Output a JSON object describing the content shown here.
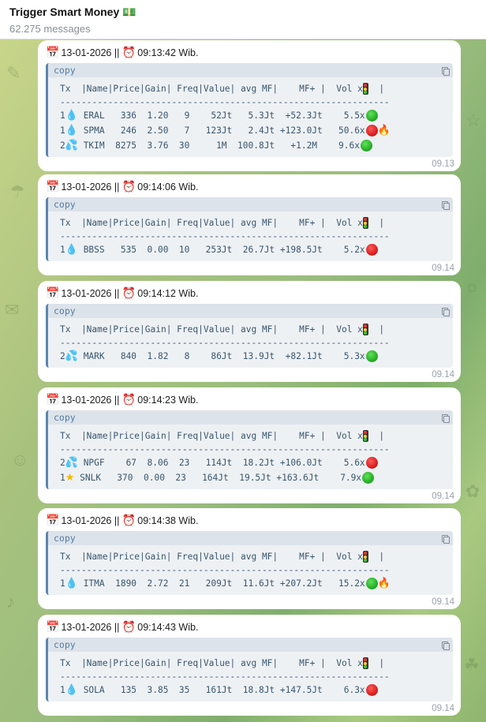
{
  "header": {
    "title": "Trigger Smart Money",
    "title_emoji": "💵",
    "subtitle": "62.275 messages"
  },
  "copy_label": "copy",
  "table_header": "Tx  |Name|Price|Gain| Freq|Value| avg MF|    MF+ |  Vol x",
  "table_header_tail": "  |",
  "separator": "--------------------------------------------------------------",
  "colors": {
    "accent": "#4f7da8",
    "green_status": "#1fa61f",
    "red_status": "#d01818"
  },
  "messages": [
    {
      "date": "13-01-2026",
      "time_label": "09:13:42 Wib.",
      "sent": "09.13",
      "rows": [
        {
          "tx": "1",
          "icon": "droplet-icon",
          "text": "ERAL   336  1.20   9    52Jt   5.3Jt  +52.3Jt    5.5x",
          "status": "green",
          "fire": false
        },
        {
          "tx": "1",
          "icon": "droplet-icon",
          "text": "SPMA   246  2.50   7   123Jt   2.4Jt +123.0Jt   50.6x",
          "status": "red",
          "fire": true
        },
        {
          "tx": "2",
          "icon": "droplets-icon",
          "text": "TKIM  8275  3.76  30     1M  100.8Jt   +1.2M    9.6x",
          "status": "green",
          "fire": false
        }
      ]
    },
    {
      "date": "13-01-2026",
      "time_label": "09:14:06 Wib.",
      "sent": "09.14",
      "rows": [
        {
          "tx": "1",
          "icon": "droplet-icon",
          "text": "BBSS   535  0.00  10   253Jt  26.7Jt +198.5Jt    5.2x",
          "status": "red",
          "fire": false
        }
      ]
    },
    {
      "date": "13-01-2026",
      "time_label": "09:14:12 Wib.",
      "sent": "09.14",
      "rows": [
        {
          "tx": "2",
          "icon": "droplets-icon",
          "text": "MARK   840  1.82   8    86Jt  13.9Jt  +82.1Jt    5.3x",
          "status": "green",
          "fire": false
        }
      ]
    },
    {
      "date": "13-01-2026",
      "time_label": "09:14:23 Wib.",
      "sent": "09.14",
      "rows": [
        {
          "tx": "2",
          "icon": "droplets-icon",
          "text": "NPGF    67  8.06  23   114Jt  18.2Jt +106.0Jt    5.6x",
          "status": "red",
          "fire": false
        },
        {
          "tx": "1",
          "icon": "star-icon",
          "text": "SNLK   370  0.00  23   164Jt  19.5Jt +163.6Jt    7.9x",
          "status": "green",
          "fire": false
        }
      ]
    },
    {
      "date": "13-01-2026",
      "time_label": "09:14:38 Wib.",
      "sent": "09.14",
      "rows": [
        {
          "tx": "1",
          "icon": "droplet-icon",
          "text": "ITMA  1890  2.72  21   209Jt  11.6Jt +207.2Jt   15.2x",
          "status": "green",
          "fire": true
        }
      ]
    },
    {
      "date": "13-01-2026",
      "time_label": "09:14:43 Wib.",
      "sent": "09.14",
      "rows": [
        {
          "tx": "1",
          "icon": "droplet-icon",
          "text": "SOLA   135  3.85  35   161Jt  18.8Jt +147.5Jt    6.3x",
          "status": "red",
          "fire": false
        }
      ]
    }
  ]
}
